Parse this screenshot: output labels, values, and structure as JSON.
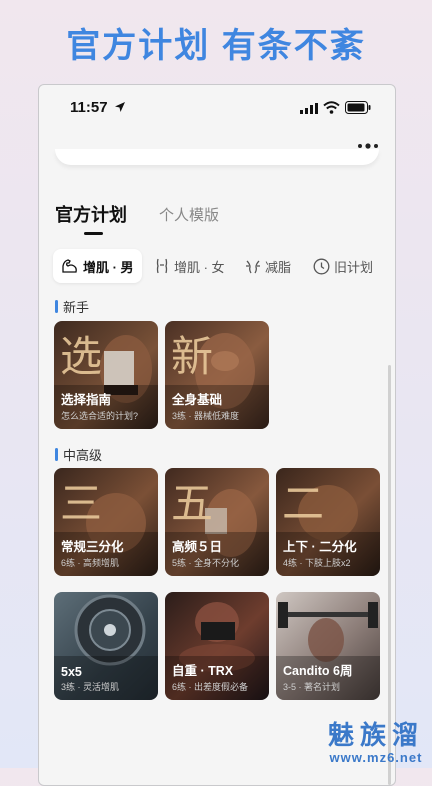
{
  "headline": "官方计划 有条不紊",
  "status": {
    "time": "11:57"
  },
  "tabs": [
    {
      "label": "官方计划",
      "active": true
    },
    {
      "label": "个人模版",
      "active": false
    }
  ],
  "filters": [
    {
      "label": "增肌 · 男",
      "icon": "arm-icon",
      "active": true
    },
    {
      "label": "增肌 · 女",
      "icon": "figure-icon",
      "active": false
    },
    {
      "label": "减脂",
      "icon": "body-icon",
      "active": false
    },
    {
      "label": "旧计划",
      "icon": "clock-icon",
      "active": false
    }
  ],
  "sections": [
    {
      "label": "新手",
      "cards": [
        {
          "char": "选",
          "title": "选择指南",
          "subtitle": "怎么选合适的计划?",
          "color": "#5a3c2c"
        },
        {
          "char": "新",
          "title": "全身基础",
          "subtitle": "3练 · 器械低难度",
          "color": "#6b4532"
        }
      ]
    },
    {
      "label": "中高级",
      "cards": [
        {
          "char": "三",
          "title": "常规三分化",
          "subtitle": "6练 · 高频增肌",
          "color": "#5c3f2e"
        },
        {
          "char": "五",
          "title": "高频５日",
          "subtitle": "5练 · 全身不分化",
          "color": "#634232"
        },
        {
          "char": "二",
          "title": "上下 · 二分化",
          "subtitle": "4练 · 下肢上肢x2",
          "color": "#5a3a2b"
        },
        {
          "char": "",
          "title": "5x5",
          "subtitle": "3练 · 灵活增肌",
          "color": "#4a5a66"
        },
        {
          "char": "",
          "title": "自重 · TRX",
          "subtitle": "6练 · 出差度假必备",
          "color": "#4a2e2a"
        },
        {
          "char": "",
          "title": "Candito 6周",
          "subtitle": "3-5 · 著名计划",
          "color": "#7a7070"
        }
      ]
    }
  ],
  "watermark": {
    "line1": "魅族溜",
    "line2": "www.mz6.net"
  }
}
